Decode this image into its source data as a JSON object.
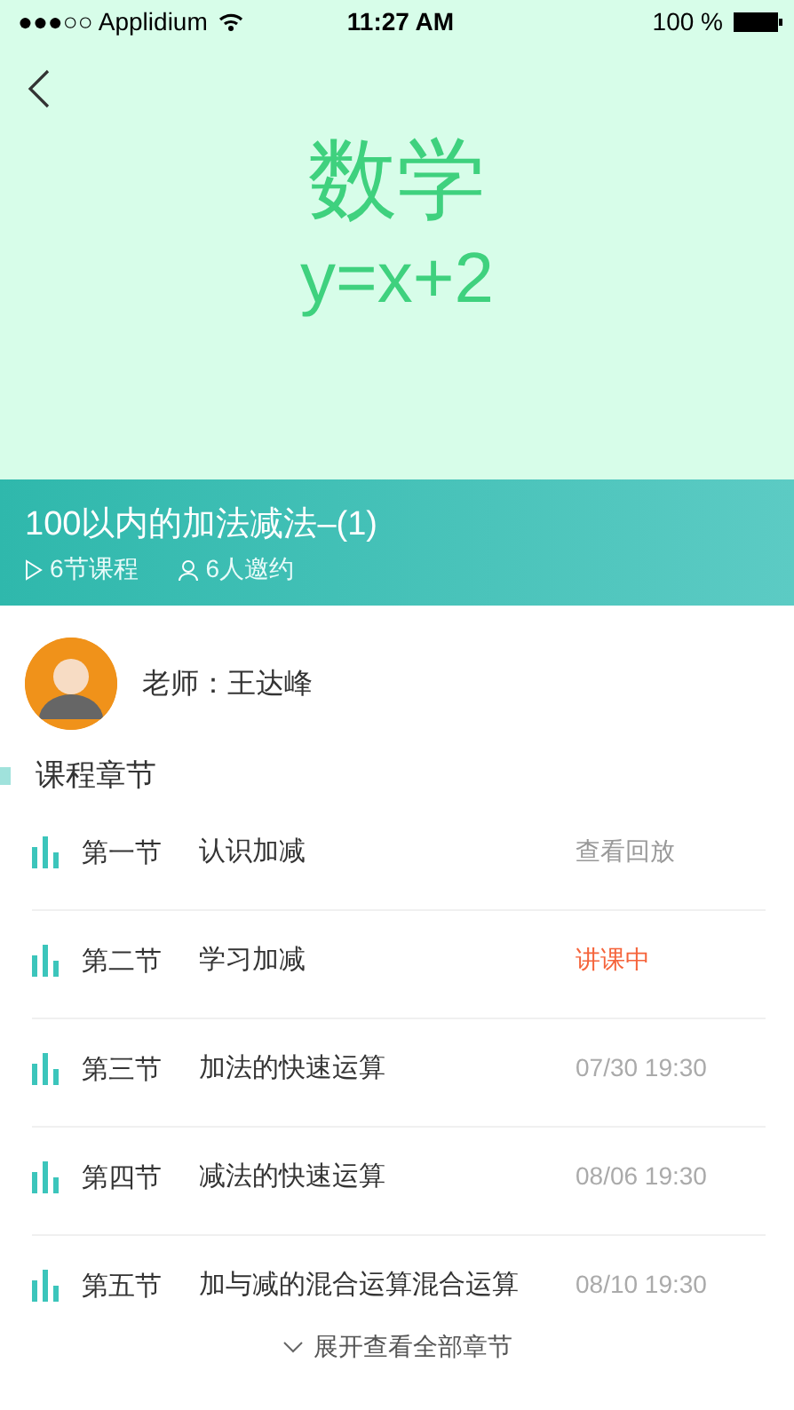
{
  "status_bar": {
    "carrier": "●●●○○ Applidium",
    "time": "11:27 AM",
    "battery": "100 %"
  },
  "hero": {
    "subject": "数学",
    "formula": "y=x+2"
  },
  "course": {
    "title": "100以内的加法减法–(1)",
    "lessons": "6节课程",
    "invites": "6人邀约"
  },
  "teacher": {
    "label": "老师：王达峰"
  },
  "section_title": "课程章节",
  "chapters": [
    {
      "number": "第一节",
      "name": "认识加减",
      "status": "查看回放",
      "kind": "replay"
    },
    {
      "number": "第二节",
      "name": "学习加减",
      "status": "讲课中",
      "kind": "live"
    },
    {
      "number": "第三节",
      "name": "加法的快速运算",
      "status": "07/30 19:30",
      "kind": "scheduled"
    },
    {
      "number": "第四节",
      "name": "减法的快速运算",
      "status": "08/06 19:30",
      "kind": "scheduled"
    },
    {
      "number": "第五节",
      "name": "加与减的混合运算混合运算",
      "status": "08/10 19:30",
      "kind": "scheduled"
    }
  ],
  "expand": "展开查看全部章节"
}
